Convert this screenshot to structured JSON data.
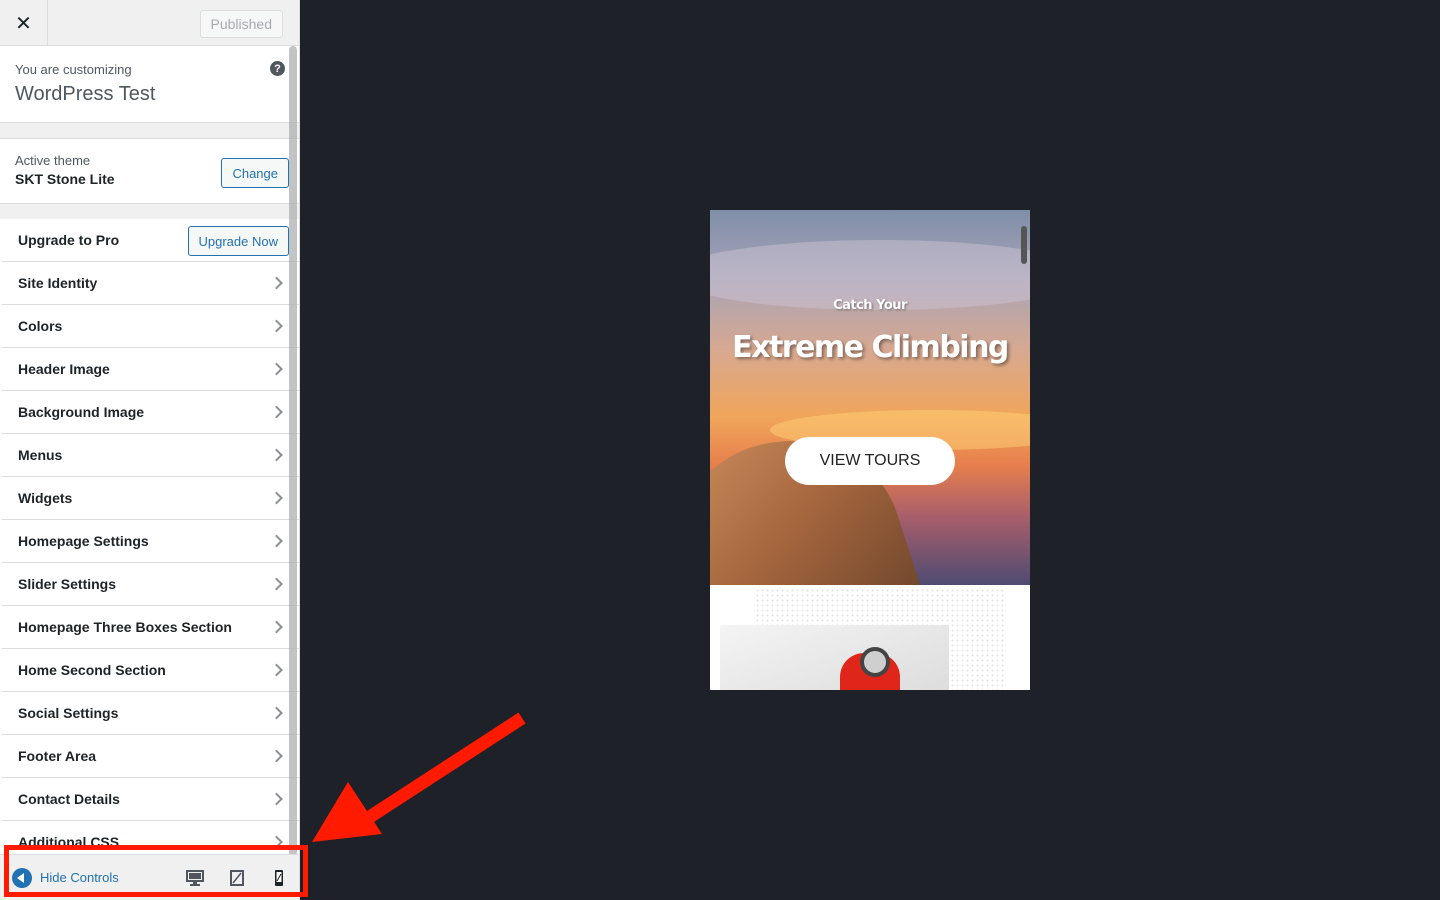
{
  "topbar": {
    "close_glyph": "✕",
    "published_label": "Published"
  },
  "info": {
    "small": "You are customizing",
    "title": "WordPress Test",
    "help_glyph": "?"
  },
  "theme": {
    "small": "Active theme",
    "name": "SKT Stone Lite",
    "change_label": "Change"
  },
  "upgrade": {
    "label": "Upgrade to Pro",
    "button": "Upgrade Now"
  },
  "menu": [
    {
      "label": "Site Identity"
    },
    {
      "label": "Colors"
    },
    {
      "label": "Header Image"
    },
    {
      "label": "Background Image"
    },
    {
      "label": "Menus"
    },
    {
      "label": "Widgets"
    },
    {
      "label": "Homepage Settings"
    },
    {
      "label": "Slider Settings"
    },
    {
      "label": "Homepage Three Boxes Section"
    },
    {
      "label": "Home Second Section"
    },
    {
      "label": "Social Settings"
    },
    {
      "label": "Footer Area"
    },
    {
      "label": "Contact Details"
    },
    {
      "label": "Additional CSS"
    }
  ],
  "footer": {
    "hide_label": "Hide Controls",
    "devices": [
      "desktop-icon",
      "tablet-icon",
      "mobile-icon"
    ],
    "active_device": "mobile"
  },
  "preview": {
    "subtitle": "Catch Your",
    "title": "Extreme Climbing",
    "button": "VIEW TOURS"
  },
  "colors": {
    "accent": "#2271b1",
    "annotation": "#ff1a00",
    "preview_bg": "#1e2128"
  }
}
